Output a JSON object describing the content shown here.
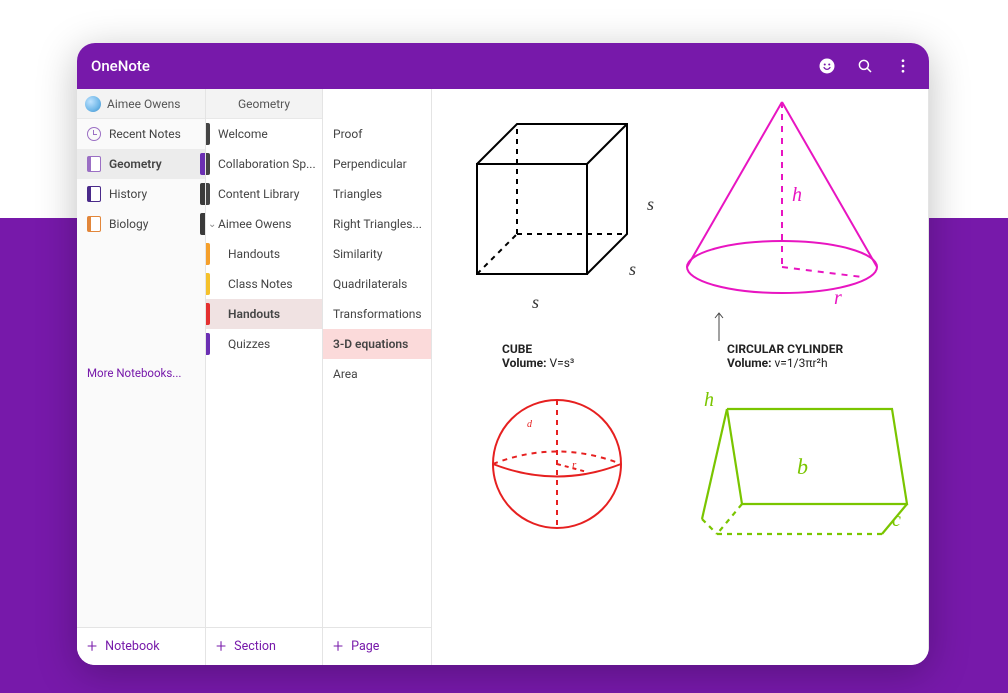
{
  "app": {
    "title": "OneNote"
  },
  "header": {
    "user_name": "Aimee Owens",
    "section_group_title": "Geometry"
  },
  "notebooks": {
    "items": [
      {
        "label": "Recent Notes",
        "icon": "clock",
        "tab": null
      },
      {
        "label": "Geometry",
        "icon": "book",
        "icon_color": "#9b6fc4",
        "tab": "#6b2fb3",
        "selected": true
      },
      {
        "label": "History",
        "icon": "book",
        "icon_color": "#4a2a8a",
        "tab": "#3a3a3a"
      },
      {
        "label": "Biology",
        "icon": "book",
        "icon_color": "#e2863a",
        "tab": "#3a3a3a"
      }
    ],
    "more_label": "More Notebooks...",
    "add_label": "Notebook"
  },
  "sections": {
    "items": [
      {
        "label": "Welcome",
        "tab": "#444"
      },
      {
        "label": "Collaboration Sp...",
        "tab": "#444"
      },
      {
        "label": "Content Library",
        "tab": "#444"
      },
      {
        "label": "Aimee Owens",
        "expandable": true
      },
      {
        "label": "Handouts",
        "child": true,
        "tab": "#f59f2b"
      },
      {
        "label": "Class Notes",
        "child": true,
        "tab": "#f5c12b"
      },
      {
        "label": "Handouts",
        "child": true,
        "tab": "#e43030",
        "selected": true
      },
      {
        "label": "Quizzes",
        "child": true,
        "tab": "#6b2fb3"
      }
    ],
    "add_label": "Section"
  },
  "pages": {
    "items": [
      {
        "label": "Proof"
      },
      {
        "label": "Perpendicular"
      },
      {
        "label": "Triangles"
      },
      {
        "label": "Right Triangles..."
      },
      {
        "label": "Similarity"
      },
      {
        "label": "Quadrilaterals"
      },
      {
        "label": "Transformations"
      },
      {
        "label": "3-D equations",
        "selected": true
      },
      {
        "label": "Area"
      }
    ],
    "add_label": "Page"
  },
  "canvas": {
    "cube": {
      "title": "CUBE",
      "formula_label": "Volume:",
      "formula": "V=s³",
      "s": "s"
    },
    "cone": {
      "title": "CIRCULAR CYLINDER",
      "formula_label": "Volume:",
      "formula": "v=1/3πr²h",
      "h": "h",
      "r": "r"
    },
    "sphere": {
      "d": "d",
      "r": "r"
    },
    "prism": {
      "h": "h",
      "b": "b",
      "c": "c"
    }
  }
}
